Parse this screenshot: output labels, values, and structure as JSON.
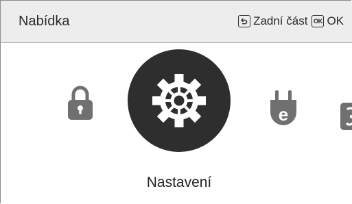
{
  "header": {
    "title": "Nabídka",
    "back_label": "Zadní část",
    "ok_key": "OK",
    "ok_label": "OK"
  },
  "menu": {
    "items": [
      {
        "icon": "lock-icon"
      },
      {
        "icon": "gear-icon",
        "label": "Nastavení",
        "selected": true
      },
      {
        "icon": "plug-e-icon"
      },
      {
        "icon": "partial-item-icon"
      }
    ],
    "selected_label": "Nastavení"
  },
  "colors": {
    "header_bg": "#ededed",
    "selected_bg": "#2e2e2e",
    "icon_gray": "#707070",
    "text": "#222222"
  }
}
